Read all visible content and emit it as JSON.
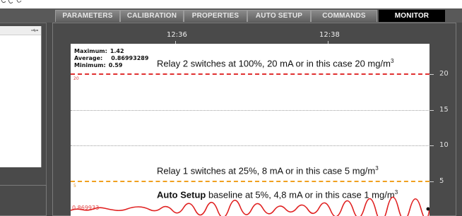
{
  "tabs": [
    {
      "label": "PARAMETERS",
      "active": false
    },
    {
      "label": "CALIBRATION",
      "active": false
    },
    {
      "label": "PROPERTIES",
      "active": false
    },
    {
      "label": "AUTO SETUP",
      "active": false
    },
    {
      "label": "COMMANDS",
      "active": false
    },
    {
      "label": "MONITOR",
      "active": true
    }
  ],
  "monitor": {
    "time_labels": [
      "12:36",
      "12:38"
    ],
    "y_axis_labels": [
      "20",
      "15",
      "10",
      "5"
    ],
    "stats": {
      "maximum_label": "Maximum:",
      "maximum_value": "1.42",
      "average_label": "Average:",
      "average_value": "0.86993289",
      "minimum_label": "Minimum:",
      "minimum_value": "0.59"
    },
    "relay2_small_label": "20",
    "relay1_small_label": "5",
    "current_value": "0.869933",
    "annotations": {
      "relay2_text": "Relay 2 switches at 100%, 20 mA or in this case 20 mg/m",
      "relay2_sup": "3",
      "relay1_text": "Relay 1 switches at 25%, 8 mA or in this case 5 mg/m",
      "relay1_sup": "3",
      "baseline_bold": "Auto Setup",
      "baseline_text": " baseline at 5%, 4,8 mA or in this case 1 mg/m",
      "baseline_sup": "3"
    }
  },
  "icons": {
    "left_panel_icon": "usb-icon"
  },
  "colors": {
    "relay2_line": "#e03030",
    "relay1_line": "#f0a020",
    "trace": "#e02020",
    "active_tab_bg": "#000000"
  }
}
